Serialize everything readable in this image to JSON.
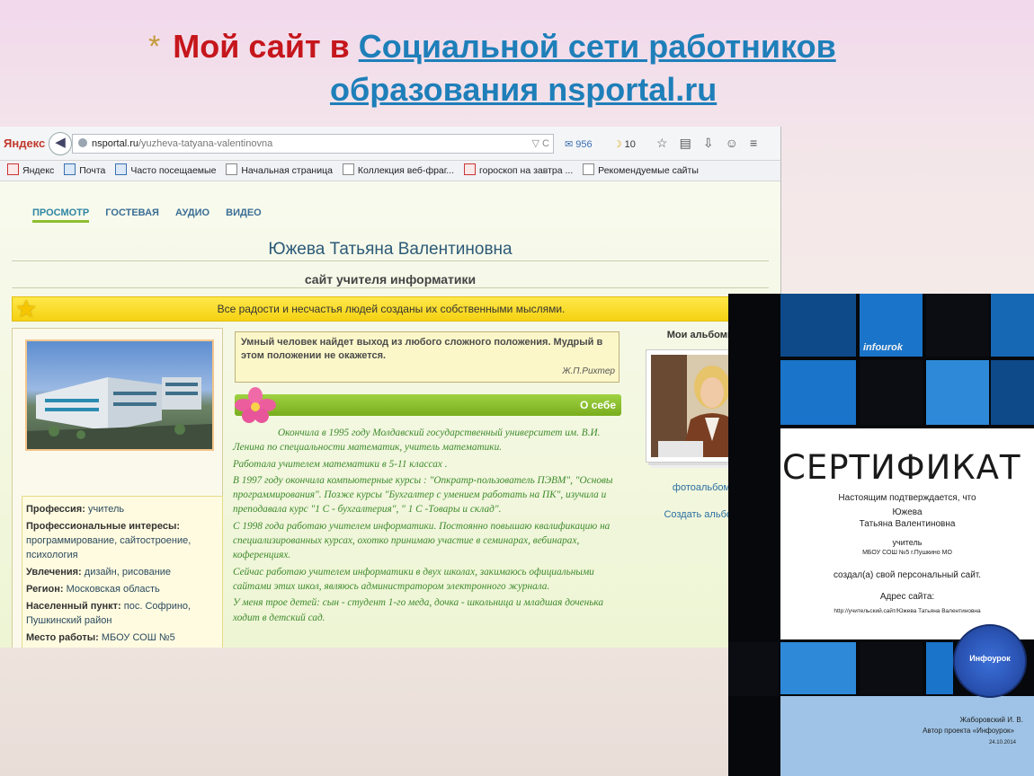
{
  "slide": {
    "bullet": "*",
    "title_prefix": "Мой сайт в ",
    "title_link_line1": "Социальной сети работников",
    "title_link_line2": "образования nsportal.ru"
  },
  "browser": {
    "logo": "Яндекс",
    "back_glyph": "◀",
    "url_host": "nsportal.ru",
    "url_path": "/yuzheva-tatyana-valentinovna",
    "url_controls": "▽ C",
    "mail_count": "956",
    "weather": "10",
    "toolbar_icons": [
      "star-icon",
      "reader-icon",
      "download-icon",
      "smile-icon",
      "menu-icon"
    ],
    "bookmarks": [
      {
        "label": "Яндекс",
        "icon": "yandex"
      },
      {
        "label": "Почта",
        "icon": "mail"
      },
      {
        "label": "Часто посещаемые",
        "icon": "page"
      },
      {
        "label": "Начальная страница",
        "icon": "page"
      },
      {
        "label": "Коллекция веб-фраг...",
        "icon": "page"
      },
      {
        "label": "гороскоп на завтра ...",
        "icon": "yandex"
      },
      {
        "label": "Рекомендуемые сайты",
        "icon": "page"
      }
    ]
  },
  "site": {
    "nav": [
      "ПРОСМОТР",
      "ГОСТЕВАЯ",
      "АУДИО",
      "ВИДЕО"
    ],
    "person_name": "Южева Татьяна Валентиновна",
    "subtitle": "сайт учителя информатики",
    "banner_quote": "Все радости и несчастья людей созданы их собственными мыслями.",
    "profile": [
      {
        "label": "Профессия:",
        "value": "учитель"
      },
      {
        "label": "Профессиональные интересы:",
        "value": "программирование, сайтостроение, психология"
      },
      {
        "label": "Увлечения:",
        "value": "дизайн, рисование"
      },
      {
        "label": "Регион:",
        "value": "Московская область"
      },
      {
        "label": "Населенный пункт:",
        "value": "пос. Софрино, Пушкинский район"
      },
      {
        "label": "Место работы:",
        "value": "МБОУ СОШ №5"
      }
    ],
    "aphorism": "Умный человек найдет выход из любого сложного положения. Мудрый в этом положении не окажется.",
    "aphorism_author": "Ж.П.Рихтер",
    "about_label": "О себе",
    "about_paragraphs": [
      "Окончила в 1995 году Молдавский государственный университет им. В.И. Ленина по специальности математик, учитель математики.",
      "Работала учителем математики в 5-11 классах .",
      "В 1997 году окончила компьютерные курсы : \"Опкратр-пользователь ПЭВМ\", \"Основы программирования\". Позже курсы \"Бухгалтер с умением работать на ПК\", изучила и преподавала курс \"1 С - бухгалтерия\", \" 1 С -Товары и склад\".",
      "С 1998 года работаю учителем информатики. Постоянно повышаю квалификацию на специализированных курсах, охотко принимаю участие в семинарах, вебинарах, коференциях.",
      "Сейчас работаю учителем информатики в двух школах, закимаюсь официальными сайтами этих школ, являюсь администратором электронного журнала.",
      "У меня трое детей: сын - студент 1-го меда, дочка - школьница и младшая доченька ходит в детский сад."
    ],
    "albums_title": "Мои альбомы",
    "album_link": "фотоальбом",
    "create_album": "Создать альбом"
  },
  "certificate": {
    "logo": "infourok",
    "title": "СЕРТИФИКАТ",
    "confirm": "Настоящим подтверждается, что",
    "name1": "Южева",
    "name2": "Татьяна Валентиновна",
    "role": "учитель",
    "school": "МБОУ СОШ №5 г.Пушкино МО",
    "created": "создал(а) свой персональный сайт.",
    "address_label": "Адрес сайта:",
    "address": "http://учительский.сайт/Южева Татьяна Валентиновна",
    "seal_text": "Инфоурок",
    "signer": "Жаборовский И. В.",
    "signer_role": "Автор проекта «Инфоурок»",
    "date": "24.10.2014",
    "colors": {
      "dark": "#06080c",
      "blue": "#1a74c9",
      "light_blue": "#9ec3e6"
    }
  }
}
